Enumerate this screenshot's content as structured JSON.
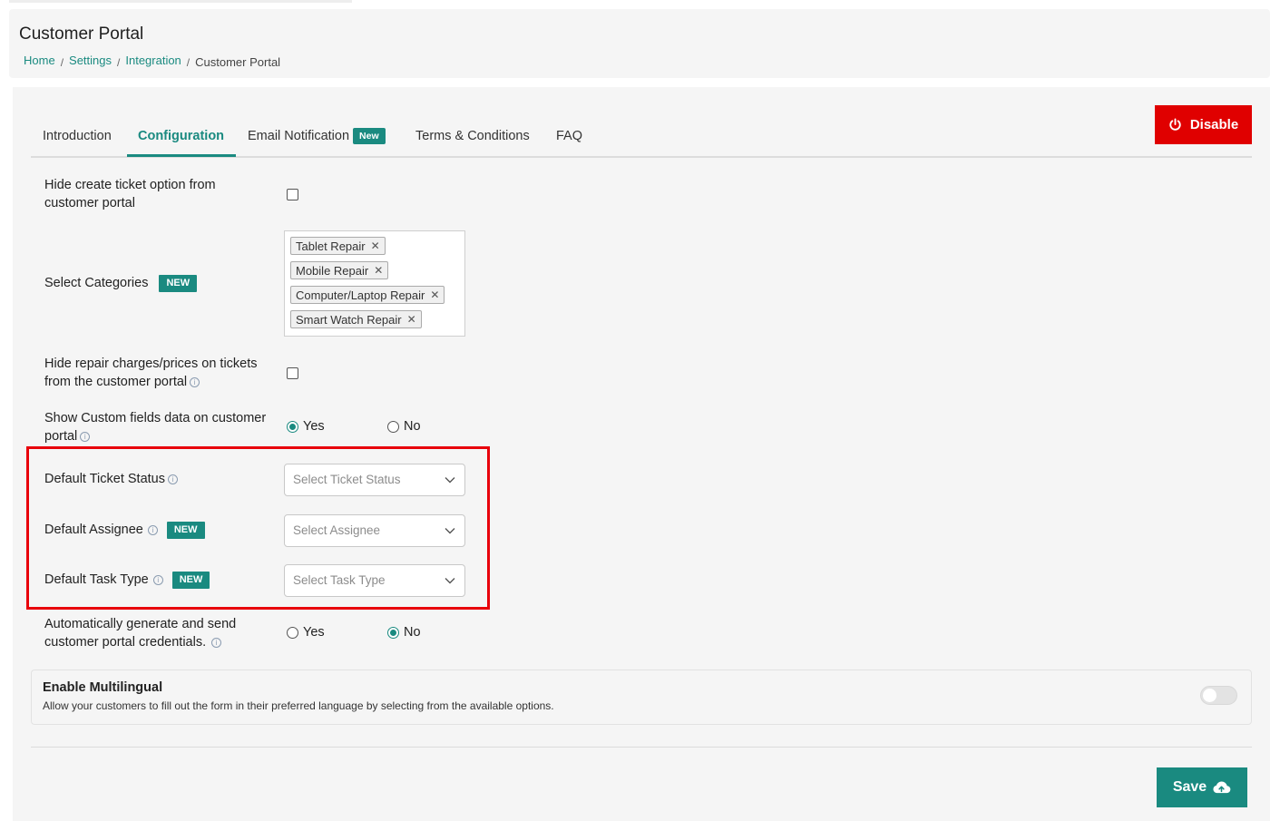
{
  "header": {
    "title": "Customer Portal",
    "breadcrumb": [
      "Home",
      "Settings",
      "Integration",
      "Customer Portal"
    ]
  },
  "tabs": [
    {
      "label": "Introduction"
    },
    {
      "label": "Configuration",
      "active": true
    },
    {
      "label": "Email Notification",
      "badge": "New"
    },
    {
      "label": "Terms & Conditions"
    },
    {
      "label": "FAQ"
    }
  ],
  "disable_button": "Disable",
  "settings": {
    "hide_create_ticket": {
      "label_line1": "Hide create ticket option from",
      "label_line2": "customer portal",
      "checked": false
    },
    "select_categories": {
      "label": "Select Categories",
      "badge": "NEW",
      "chips": [
        "Tablet Repair",
        "Mobile Repair",
        "Computer/Laptop Repair",
        "Smart Watch Repair"
      ],
      "remove_glyph": "✕"
    },
    "hide_repair_charges": {
      "label_line1": "Hide repair charges/prices on tickets",
      "label_line2": "from the customer portal",
      "checked": false
    },
    "show_custom_fields": {
      "label_line1": "Show Custom fields data on customer",
      "label_line2": "portal",
      "yes": "Yes",
      "no": "No",
      "selected": "Yes"
    },
    "default_ticket_status": {
      "label": "Default Ticket Status",
      "placeholder": "Select Ticket Status"
    },
    "default_assignee": {
      "label": "Default Assignee",
      "badge": "NEW",
      "placeholder": "Select Assignee"
    },
    "default_task_type": {
      "label": "Default Task Type",
      "badge": "NEW",
      "placeholder": "Select Task Type"
    },
    "auto_credentials": {
      "label_line1": "Automatically generate and send",
      "label_line2": "customer portal credentials.",
      "yes": "Yes",
      "no": "No",
      "selected": "No"
    }
  },
  "multilingual": {
    "title": "Enable Multilingual",
    "description": "Allow your customers to fill out the form in their preferred language by selecting from the available options.",
    "enabled": false
  },
  "save_button": "Save",
  "colors": {
    "accent": "#1a8a80",
    "danger": "#e00000",
    "highlight": "#e8000b"
  }
}
